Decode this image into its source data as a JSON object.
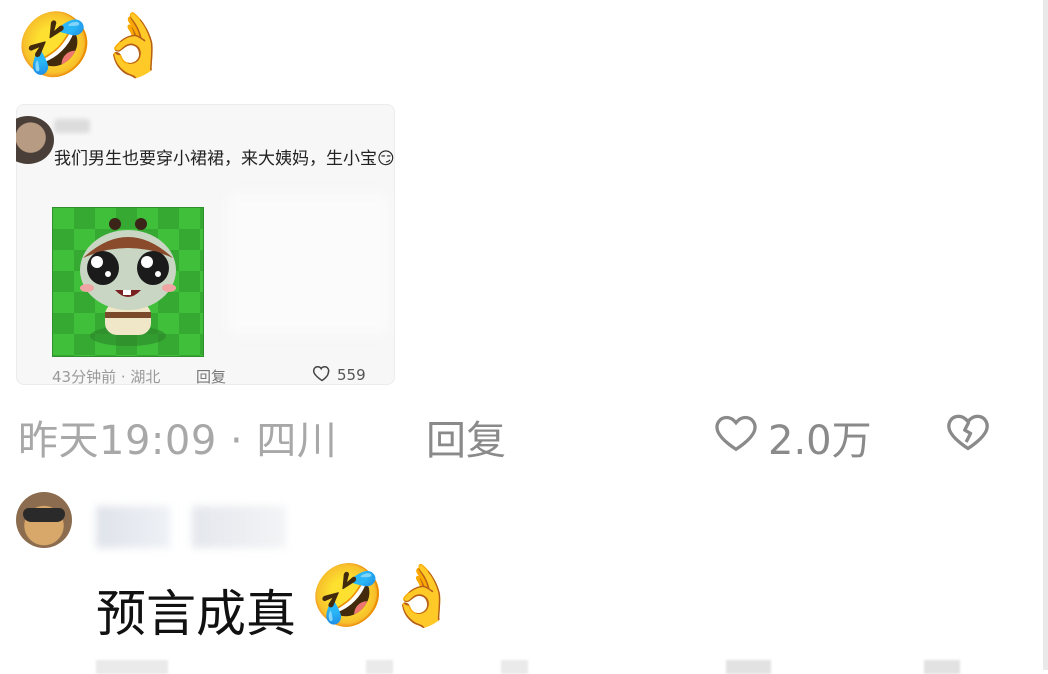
{
  "top_comment": {
    "emojis": "🤣👌"
  },
  "embedded_screenshot": {
    "comment_text": "我们男生也要穿小裙裙，来大姨妈，生小宝😏",
    "meta": "43分钟前 · 湖北",
    "reply_label": "回复",
    "like_count": "559",
    "sticker_icon": "cartoon-sticker"
  },
  "comment_meta": {
    "time_location": "昨天19:09 · 四川",
    "reply_label": "回复",
    "like_count": "2.0万",
    "like_icon": "heart-outline-icon",
    "dislike_icon": "broken-heart-icon"
  },
  "second_comment": {
    "text": "预言成真",
    "emojis": "🤣👌"
  },
  "colors": {
    "meta_gray": "#a8a8a8",
    "action_gray": "#8a8a8a",
    "sticker_green": "#3fbf3a"
  }
}
